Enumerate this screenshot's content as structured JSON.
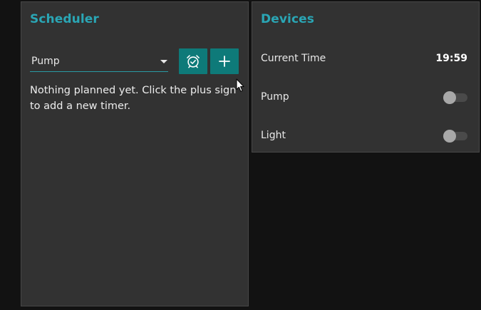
{
  "scheduler": {
    "title": "Scheduler",
    "selected_device": "Pump",
    "alarm_icon": "alarm-clock-icon",
    "add_icon": "plus-icon",
    "empty_message": "Nothing planned yet. Click the plus sign to add a new timer."
  },
  "devices": {
    "title": "Devices",
    "current_time_label": "Current Time",
    "current_time_value": "19:59",
    "items": [
      {
        "label": "Pump",
        "on": false
      },
      {
        "label": "Light",
        "on": false
      }
    ]
  },
  "colors": {
    "background": "#121212",
    "panel": "#323232",
    "accent_title": "#2aa6b5",
    "button": "#0e7a79",
    "toggle_track": "#4a4a4a",
    "toggle_knob": "#a8a8a8"
  }
}
